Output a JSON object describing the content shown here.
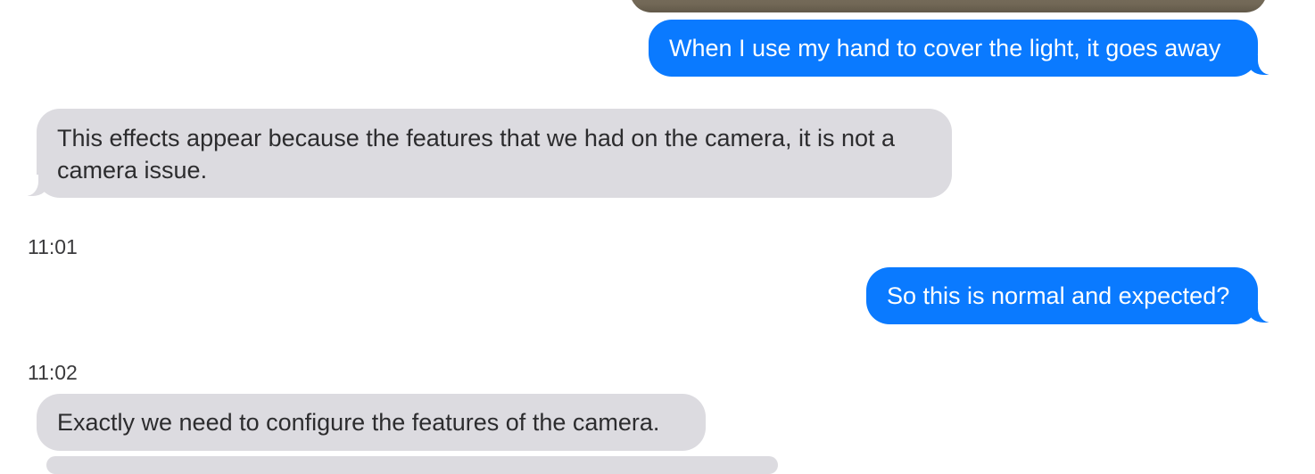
{
  "conversation": {
    "messages": [
      {
        "direction": "sent",
        "text": "When I use my hand to cover the light, it goes away"
      },
      {
        "direction": "received",
        "text": "This effects appear because the features that we had on the camera, it is not a camera issue."
      },
      {
        "direction": "sent",
        "text": "So this is normal and expected?"
      },
      {
        "direction": "received",
        "text": "Exactly we need to configure the features of the camera."
      }
    ],
    "timestamps": [
      "11:01",
      "11:02"
    ]
  },
  "colors": {
    "sent_bubble": "#0a7aff",
    "received_bubble": "#dcdbe0",
    "background": "#ffffff"
  }
}
